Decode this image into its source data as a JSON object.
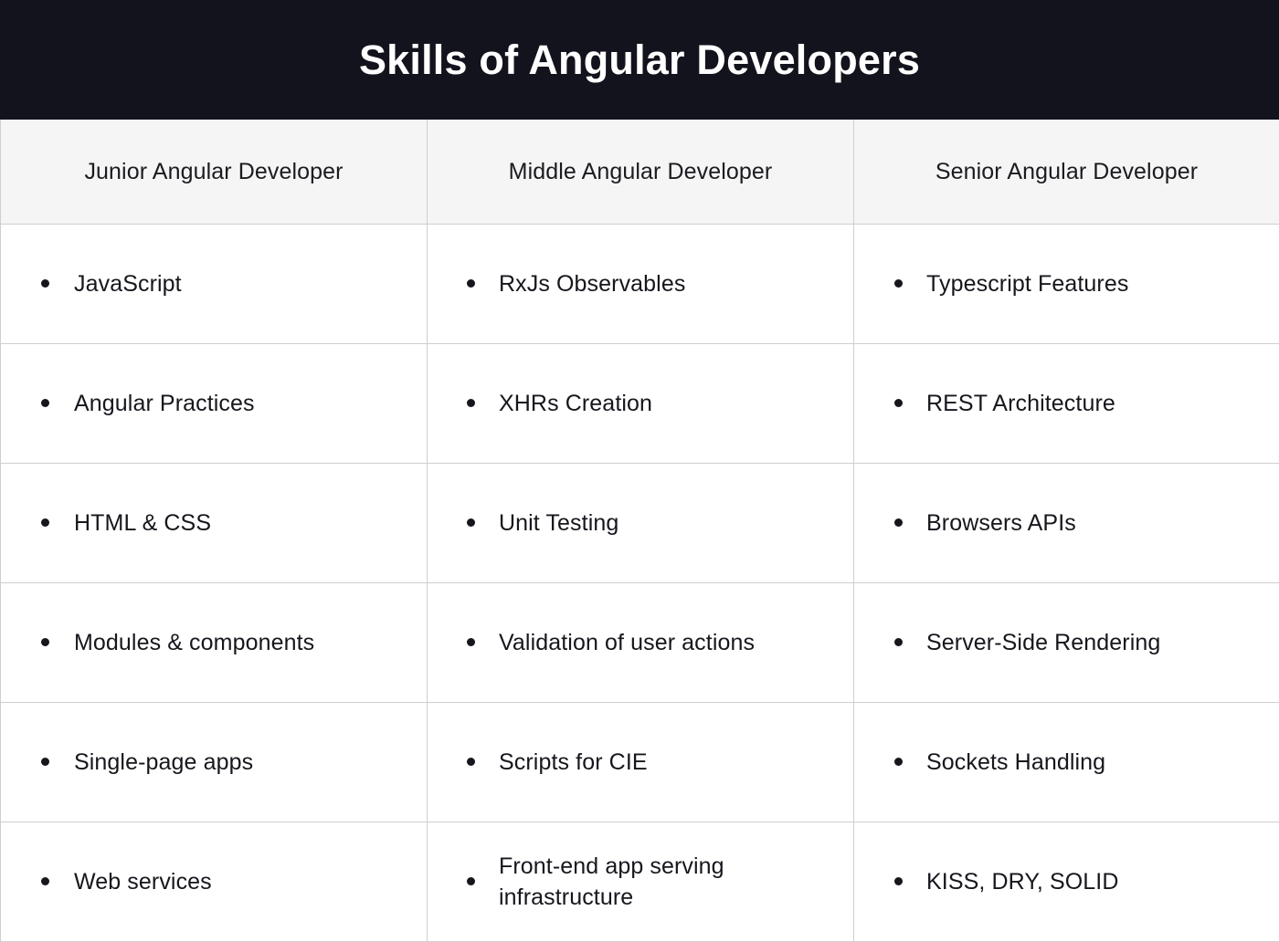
{
  "title": "Skills of Angular Developers",
  "colors": {
    "banner_background": "#13131d",
    "banner_text": "#ffffff",
    "header_row_background": "#f5f5f6",
    "cell_background": "#ffffff",
    "border": "#cfcfd1",
    "text": "#16161d",
    "bullet": "#16161d"
  },
  "table": {
    "columns": [
      {
        "label": "Junior Angular Developer"
      },
      {
        "label": "Middle Angular Developer"
      },
      {
        "label": "Senior Angular Developer"
      }
    ],
    "rows": [
      {
        "junior": "JavaScript",
        "middle": "RxJs Observables",
        "senior": "Typescript Features"
      },
      {
        "junior": "Angular Practices",
        "middle": "XHRs Creation",
        "senior": "REST Architecture"
      },
      {
        "junior": "HTML & CSS",
        "middle": "Unit Testing",
        "senior": "Browsers APIs"
      },
      {
        "junior": "Modules & components",
        "middle": "Validation of user actions",
        "senior": "Server-Side Rendering"
      },
      {
        "junior": "Single-page apps",
        "middle": "Scripts for CIE",
        "senior": "Sockets Handling"
      },
      {
        "junior": "Web services",
        "middle": "Front-end app serving infrastructure",
        "senior": "KISS, DRY, SOLID"
      }
    ]
  }
}
